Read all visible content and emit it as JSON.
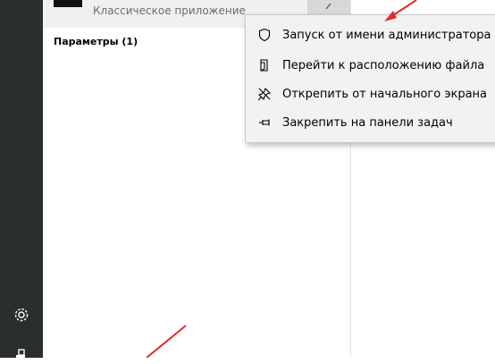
{
  "top_result": {
    "app_subtitle": "Классическое приложение"
  },
  "section": {
    "title": "Параметры (1)"
  },
  "context_menu": {
    "items": [
      {
        "label": "Запуск от имени администратора",
        "icon": "shield-icon"
      },
      {
        "label": "Перейти к расположению файла",
        "icon": "file-location-icon"
      },
      {
        "label": "Открепить от начального экрана",
        "icon": "unpin-icon"
      },
      {
        "label": "Закрепить на панели задач",
        "icon": "pin-taskbar-icon"
      }
    ]
  },
  "colors": {
    "rail": "#2b2f2c",
    "menu_bg": "#f2f2f2",
    "annotation_arrow": "#e8262b"
  },
  "rail_icons": [
    "gear-icon",
    "user-icon"
  ]
}
